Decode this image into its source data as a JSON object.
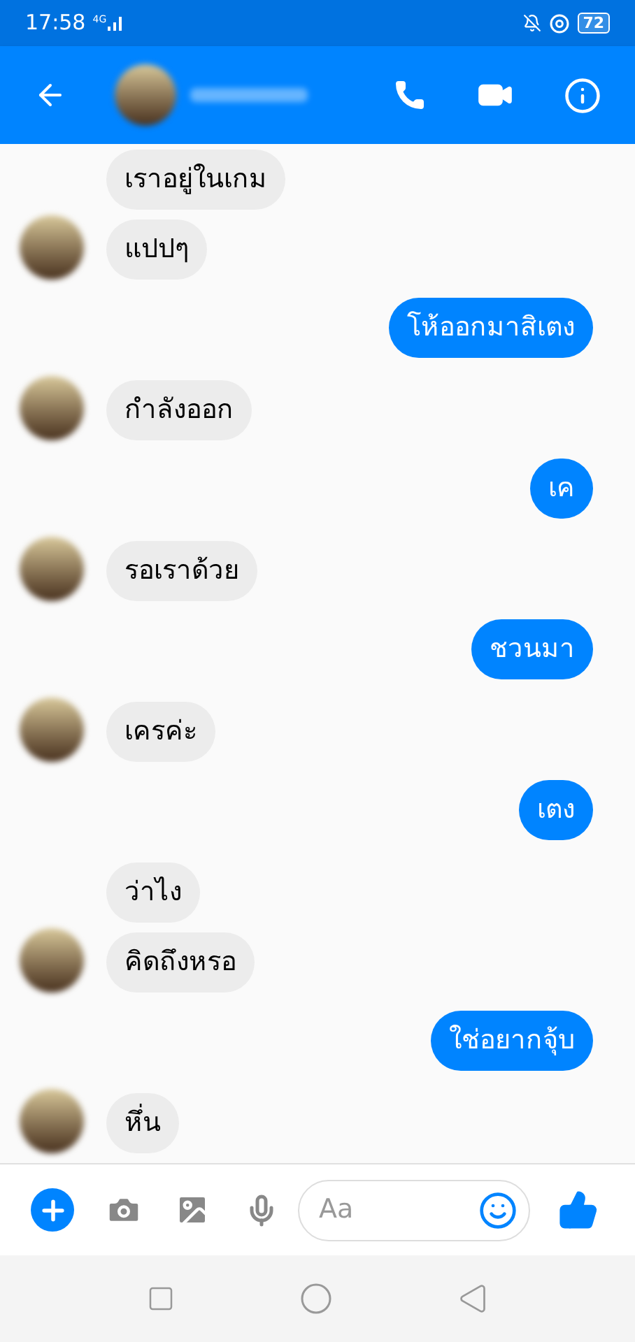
{
  "status_bar": {
    "time": "17:58",
    "network": "4G",
    "battery": "72"
  },
  "messages": [
    {
      "kind": "incoming",
      "text": "เราอยู่ในเกม",
      "avatar": false
    },
    {
      "kind": "incoming",
      "text": "แปปๆ",
      "avatar": true
    },
    {
      "kind": "outgoing",
      "text": "โห้ออกมาสิเตง"
    },
    {
      "kind": "incoming",
      "text": "กำลังออก",
      "avatar": true
    },
    {
      "kind": "outgoing",
      "text": "เค"
    },
    {
      "kind": "incoming",
      "text": "รอเราด้วย",
      "avatar": true
    },
    {
      "kind": "outgoing",
      "text": "ชวนมา"
    },
    {
      "kind": "incoming",
      "text": "เครค่ะ",
      "avatar": true
    },
    {
      "kind": "outgoing",
      "text": "เตง"
    },
    {
      "kind": "incoming",
      "text": "ว่าไง",
      "avatar": false
    },
    {
      "kind": "incoming",
      "text": "คิดถึงหรอ",
      "avatar": true
    },
    {
      "kind": "outgoing",
      "text": "ใช่อยากจุ้บ"
    },
    {
      "kind": "incoming",
      "text": "หึ่น",
      "avatar": true
    }
  ],
  "composer": {
    "placeholder": "Aa"
  }
}
